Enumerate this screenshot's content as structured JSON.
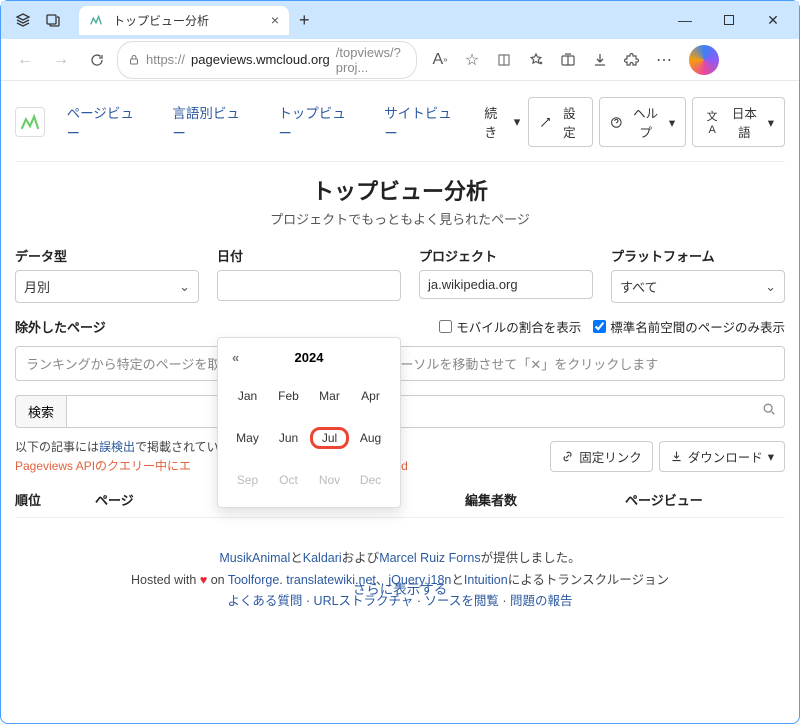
{
  "browser": {
    "tab_title": "トップビュー分析",
    "url_proto": "https://",
    "url_domain": "pageviews.wmcloud.org",
    "url_path": "/topviews/?proj..."
  },
  "nav": {
    "pageview": "ページビュー",
    "langview": "言語別ビュー",
    "topview": "トップビュー",
    "siteview": "サイトビュー",
    "continue": "続き",
    "settings": "設定",
    "help": "ヘルプ",
    "lang": "日本語"
  },
  "heading": {
    "title": "トップビュー分析",
    "subtitle": "プロジェクトでもっともよく見られたページ"
  },
  "filters": {
    "datatype_label": "データ型",
    "datatype_value": "月別",
    "date_label": "日付",
    "project_label": "プロジェクト",
    "project_value": "ja.wikipedia.org",
    "platform_label": "プラットフォーム",
    "platform_value": "すべて",
    "excluded_label": "除外したページ",
    "mobile_ratio": "モバイルの割合を表示",
    "namespace_only": "標準名前空間のページのみ表示",
    "excluded_placeholder_start": "ランキングから特定のページを取",
    "excluded_placeholder_end": "ーソルを移動させて「✕」をクリックします",
    "search": "検索"
  },
  "meta": {
    "note_prefix": "以下の記事には",
    "note_link": "誤検出",
    "note_suffix": "で掲載されている",
    "err_prefix": "Pageviews APIのクエリー中にエ",
    "err_suffix": "ound",
    "permalink": "固定リンク",
    "download": "ダウンロード"
  },
  "table": {
    "rank": "順位",
    "page": "ページ",
    "editors": "編集者数",
    "views": "ページビュー"
  },
  "showmore": "さらに表示する",
  "footer": {
    "l1_a": "MusikAnimal",
    "l1_b": "と",
    "l1_c": "Kaldari",
    "l1_d": "および",
    "l1_e": "Marcel Ruiz Forns",
    "l1_f": "が提供しました。",
    "l2_a": "Hosted with ",
    "l2_b": " on ",
    "l2_c": "Toolforge",
    "l2_d": ". ",
    "l2_e": "translatewiki.net",
    "l2_f": "、",
    "l2_g": "jQuery.i18n",
    "l2_h": "と",
    "l2_i": "Intuition",
    "l2_j": "によるトランスクルージョン",
    "l3_a": "よくある質問",
    "l3_b": " · ",
    "l3_c": "URLストラクチャ",
    "l3_d": " · ",
    "l3_e": "ソースを閲覧",
    "l3_f": " · ",
    "l3_g": "問題の報告"
  },
  "datepicker": {
    "year": "2024",
    "months": [
      "Jan",
      "Feb",
      "Mar",
      "Apr",
      "May",
      "Jun",
      "Jul",
      "Aug",
      "Sep",
      "Oct",
      "Nov",
      "Dec"
    ],
    "selected": "Jul",
    "disabled": [
      "Sep",
      "Oct",
      "Nov",
      "Dec"
    ]
  }
}
